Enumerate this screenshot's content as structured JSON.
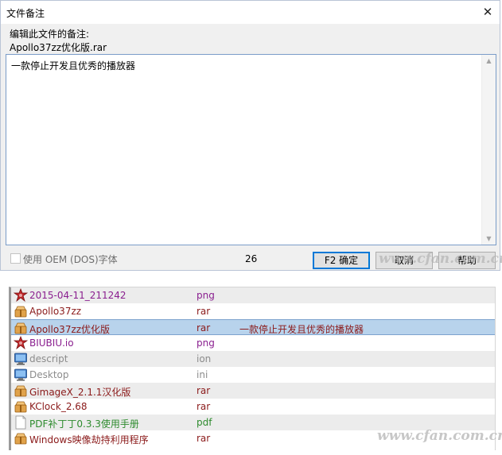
{
  "dialog": {
    "title": "文件备注",
    "close_glyph": "✕",
    "prompt": "编辑此文件的备注:",
    "filename": "Apollo37zz优化版.rar",
    "note_text": "一款停止开发且优秀的播放器",
    "checkbox_label": "使用 OEM (DOS)字体",
    "checkbox_checked": false,
    "char_count": "26",
    "ok_label": "F2 确定",
    "cancel_label": "取消",
    "help_label": "帮助"
  },
  "file_list": {
    "rows": [
      {
        "name": "2015-04-11_211242",
        "ext": "png",
        "note": "",
        "icon": "image-file-icon",
        "color": "#8a1f8f"
      },
      {
        "name": "Apollo37zz",
        "ext": "rar",
        "note": "",
        "icon": "archive-icon",
        "color": "#8b1a1a"
      },
      {
        "name": "Apollo37zz优化版",
        "ext": "rar",
        "note": "一款停止开发且优秀的播放器",
        "icon": "archive-icon",
        "color": "#8b1a1a",
        "selected": true
      },
      {
        "name": "BIUBIU.io",
        "ext": "png",
        "note": "",
        "icon": "image-file-icon",
        "color": "#8a1f8f"
      },
      {
        "name": "descript",
        "ext": "ion",
        "note": "",
        "icon": "system-file-icon",
        "color": "#8c8c8c"
      },
      {
        "name": "Desktop",
        "ext": "ini",
        "note": "",
        "icon": "system-file-icon",
        "color": "#8c8c8c"
      },
      {
        "name": "GimageX_2.1.1汉化版",
        "ext": "rar",
        "note": "",
        "icon": "archive-icon",
        "color": "#8b1a1a"
      },
      {
        "name": "KClock_2.68",
        "ext": "rar",
        "note": "",
        "icon": "archive-icon",
        "color": "#8b1a1a"
      },
      {
        "name": "PDF补丁丁0.3.3使用手册",
        "ext": "pdf",
        "note": "",
        "icon": "document-icon",
        "color": "#2e8b2e"
      },
      {
        "name": "Windows映像劫持利用程序",
        "ext": "rar",
        "note": "",
        "icon": "archive-icon",
        "color": "#8b1a1a"
      }
    ]
  },
  "watermark": "www.cfan.com.cn"
}
